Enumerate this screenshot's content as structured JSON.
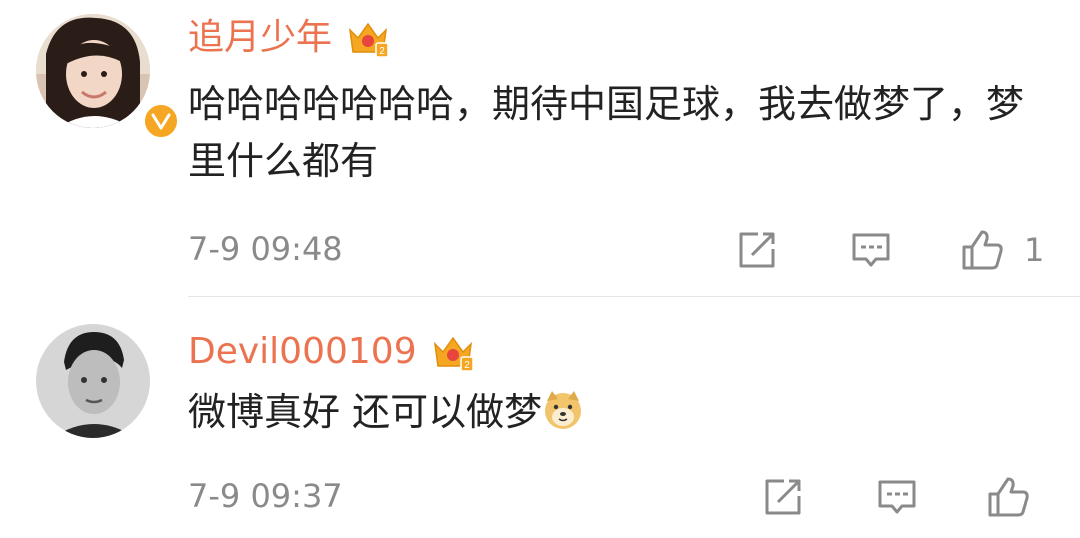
{
  "comments": [
    {
      "username": "追月少年",
      "verified": true,
      "badge_icon": "crown-vip-icon",
      "text": "哈哈哈哈哈哈哈，期待中国足球，我去做梦了，梦里什么都有",
      "timestamp": "7-9 09:48",
      "like_count": "1"
    },
    {
      "username": "Devil000109",
      "verified": false,
      "badge_icon": "crown-vip-icon",
      "text": "微博真好 还可以做梦",
      "emoji": "doge-emoji-icon",
      "timestamp": "7-9 09:37",
      "like_count": ""
    }
  ],
  "colors": {
    "username": "#eb7350",
    "text": "#222222",
    "meta": "#8a8a8a",
    "verified_badge": "#f5a623",
    "divider": "#e5e5e5"
  }
}
